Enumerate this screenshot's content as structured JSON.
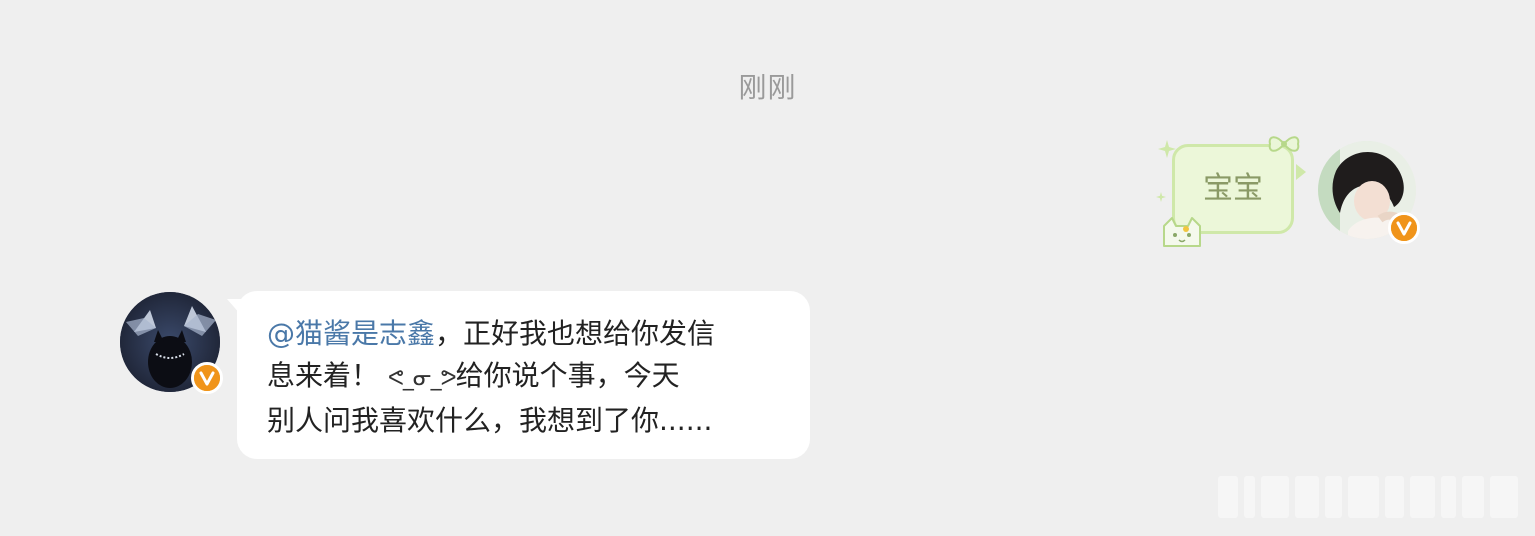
{
  "timestamp": "刚刚",
  "outgoing": {
    "text": "宝宝",
    "bubble_color": "#ecf7d9",
    "bubble_border": "#cfe8a9",
    "text_color": "#8a9a66"
  },
  "incoming": {
    "mention": "@猫酱是志鑫",
    "line1_rest": "，正好我也想给你发信",
    "line2_start": "息来着！",
    "kaomoji": "ᕙ_ᓂ_ᕗ",
    "line2_end": "给你说个事，今天",
    "line3": "别人问我喜欢什么，我想到了你......"
  },
  "badges": {
    "verify_color": "#f5a623"
  }
}
